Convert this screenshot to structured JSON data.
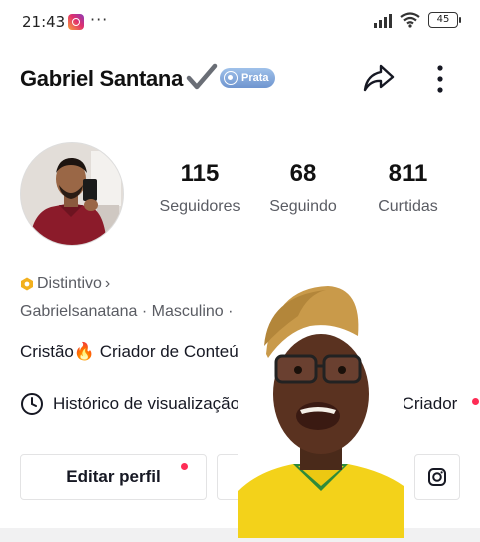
{
  "status_bar": {
    "time": "21:43",
    "dots": "···",
    "battery": "45"
  },
  "header": {
    "username": "Gabriel Santana",
    "badge_label": "Prata"
  },
  "stats": [
    {
      "value": "115",
      "label": "Seguidores"
    },
    {
      "value": "68",
      "label": "Seguindo"
    },
    {
      "value": "811",
      "label": "Curtidas"
    }
  ],
  "profile": {
    "distintivo": "Distintivo",
    "distintivo_chevron": "›",
    "meta": "Gabrielsanatana · Masculino ·",
    "bio": "Cristão🔥 Criador de Conteúd"
  },
  "history_row": {
    "history_label": "Histórico de visualização",
    "creator_label": "al do Criador"
  },
  "buttons": {
    "edit": "Editar perfil",
    "add": "A"
  },
  "colors": {
    "accent_red": "#fe2c55",
    "badge_blue": "#7fa6db",
    "distintivo_gold": "#f2b01e"
  }
}
